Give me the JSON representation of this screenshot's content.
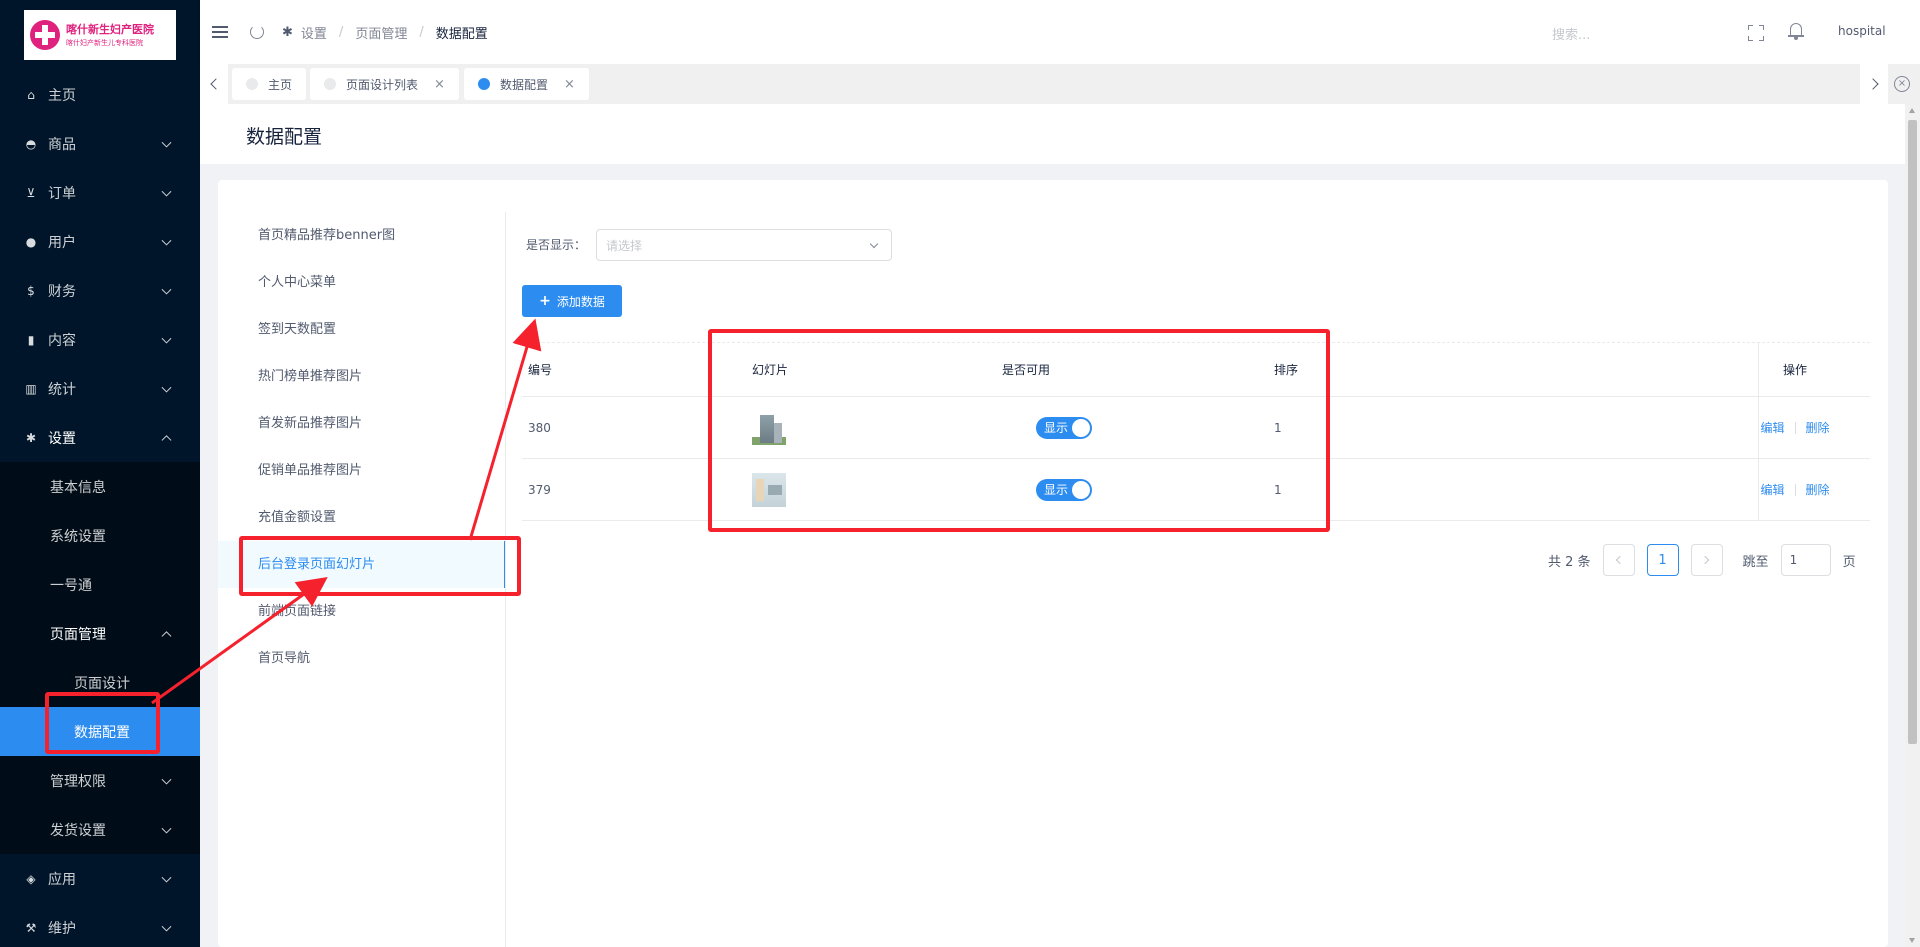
{
  "logo": {
    "line1": "喀什新生妇产医院",
    "line2": "喀什妇产新生儿专科医院"
  },
  "sidebar": {
    "items": [
      {
        "label": "主页",
        "icon": "home-icon",
        "glyph": "⌂"
      },
      {
        "label": "商品",
        "icon": "basket-icon",
        "glyph": "◓"
      },
      {
        "label": "订单",
        "icon": "cart-icon",
        "glyph": "⊻"
      },
      {
        "label": "用户",
        "icon": "user-icon",
        "glyph": "●"
      },
      {
        "label": "财务",
        "icon": "dollar-icon",
        "glyph": "$"
      },
      {
        "label": "内容",
        "icon": "book-icon",
        "glyph": "▮"
      },
      {
        "label": "统计",
        "icon": "bar-chart-icon",
        "glyph": "▥"
      },
      {
        "label": "设置",
        "icon": "gear-icon",
        "glyph": "✱"
      },
      {
        "label": "应用",
        "icon": "cube-icon",
        "glyph": "◈"
      },
      {
        "label": "维护",
        "icon": "hammer-icon",
        "glyph": "⚒"
      }
    ],
    "settings_sub": [
      "基本信息",
      "系统设置",
      "一号通",
      "页面管理",
      "管理权限",
      "发货设置"
    ],
    "page_mgmt_sub": [
      "页面设计",
      "数据配置"
    ]
  },
  "header": {
    "breadcrumb": [
      "设置",
      "页面管理",
      "数据配置"
    ],
    "search_placeholder": "搜索...",
    "user": "hospital"
  },
  "tabs": [
    {
      "label": "主页"
    },
    {
      "label": "页面设计列表"
    },
    {
      "label": "数据配置"
    }
  ],
  "page_title": "数据配置",
  "left_menu": [
    "首页精品推荐benner图",
    "个人中心菜单",
    "签到天数配置",
    "热门榜单推荐图片",
    "首发新品推荐图片",
    "促销单品推荐图片",
    "充值金额设置",
    "后台登录页面幻灯片",
    "前端页面链接",
    "首页导航"
  ],
  "filter": {
    "label": "是否显示：",
    "placeholder": "请选择"
  },
  "add_button": "添加数据",
  "table": {
    "headers": [
      "编号",
      "幻灯片",
      "是否可用",
      "排序",
      "操作"
    ],
    "rows": [
      {
        "id": "380",
        "switch": "显示",
        "sort": "1",
        "edit": "编辑",
        "delete": "删除"
      },
      {
        "id": "379",
        "switch": "显示",
        "sort": "1",
        "edit": "编辑",
        "delete": "删除"
      }
    ]
  },
  "pagination": {
    "total": "共 2 条",
    "current": "1",
    "jump_label": "跳至",
    "jump_value": "1",
    "page_suffix": "页"
  },
  "colors": {
    "primary": "#2d8cf0",
    "sidebar_bg": "#001529",
    "annotation": "#f5222d"
  }
}
